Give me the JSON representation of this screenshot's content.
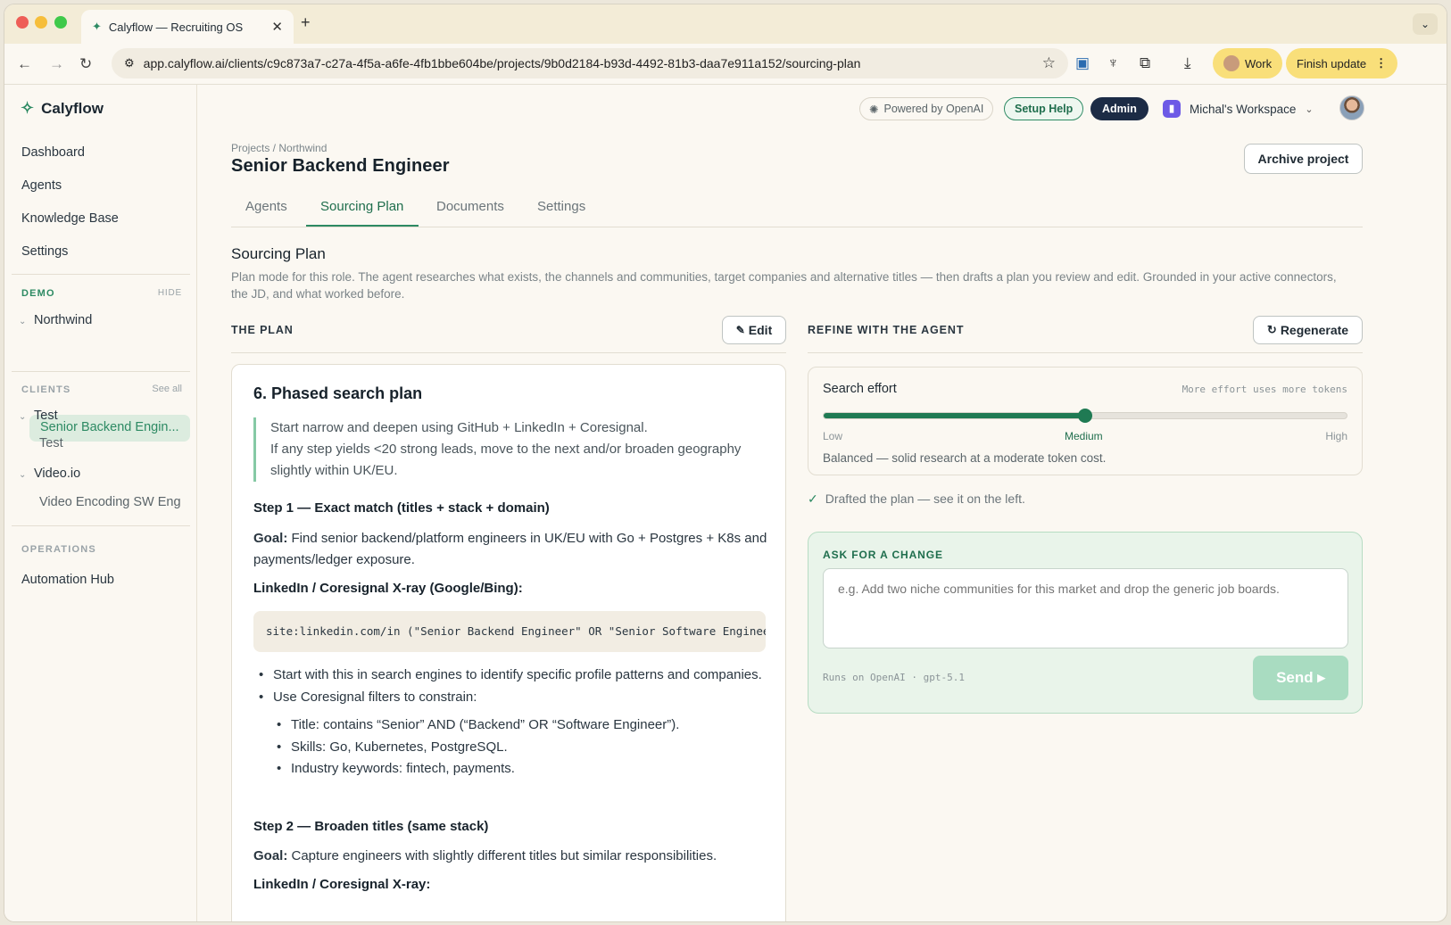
{
  "browser": {
    "tab_title": "Calyflow — Recruiting OS",
    "url": "app.calyflow.ai/clients/c9c873a7-c27a-4f5a-a6fe-4fb1bbe604be/projects/9b0d2184-b93d-4492-81b3-daa7e911a152/sourcing-plan",
    "profile_label": "Work",
    "update_label": "Finish update"
  },
  "sidebar": {
    "brand": "Calyflow",
    "nav": [
      "Dashboard",
      "Agents",
      "Knowledge Base",
      "Settings"
    ],
    "demo_label": "DEMO",
    "demo_hide": "HIDE",
    "demo_group": "Northwind",
    "demo_active": "Senior Backend Engin...",
    "clients_label": "CLIENTS",
    "clients_see_all": "See all",
    "client1": "Test",
    "client1_child": "Test",
    "client2": "Video.io",
    "client2_child": "Video Encoding SW Eng",
    "operations_label": "OPERATIONS",
    "operations_item": "Automation Hub"
  },
  "header": {
    "powered": "Powered by OpenAI",
    "setup_help": "Setup Help",
    "admin": "Admin",
    "workspace": "Michal's Workspace"
  },
  "page": {
    "breadcrumb": "Projects / Northwind",
    "title": "Senior Backend Engineer",
    "archive": "Archive project",
    "tabs": [
      "Agents",
      "Sourcing Plan",
      "Documents",
      "Settings"
    ],
    "section_title": "Sourcing Plan",
    "section_desc": "Plan mode for this role. The agent researches what exists, the channels and communities, target companies and alternative titles — then drafts a plan you review and edit. Grounded in your active connectors, the JD, and what worked before."
  },
  "plan": {
    "header": "THE PLAN",
    "edit": "Edit",
    "heading": "6. Phased search plan",
    "quote_1": "Start narrow and deepen using GitHub + LinkedIn + Coresignal.",
    "quote_2": "If any step yields <20 strong leads, move to the next and/or broaden geography slightly within UK/EU.",
    "step1_title": "Step 1 — Exact match (titles + stack + domain)",
    "goal_label": "Goal:",
    "step1_goal": " Find senior backend/platform engineers in UK/EU with Go + Postgres + K8s and payments/ledger exposure.",
    "xray_title": "LinkedIn / Coresignal X-ray (Google/Bing):",
    "xray_code": "site:linkedin.com/in (\"Senior Backend Engineer\" OR \"Senior Software Engineer\")",
    "bullet1": "Start with this in search engines to identify specific profile patterns and companies.",
    "bullet2": "Use Coresignal filters to constrain:",
    "sub1": "Title: contains “Senior” AND (“Backend” OR “Software Engineer”).",
    "sub2": "Skills: Go, Kubernetes, PostgreSQL.",
    "sub3": "Industry keywords: fintech, payments.",
    "step2_title": "Step 2 — Broaden titles (same stack)",
    "goal_label_2": "Goal:",
    "step2_goal": " Capture engineers with slightly different titles but similar responsibilities.",
    "xray_title_2": "LinkedIn / Coresignal X-ray:"
  },
  "refine": {
    "header": "REFINE WITH THE AGENT",
    "regenerate": "Regenerate",
    "effort_title": "Search effort",
    "effort_hint": "More effort uses more tokens",
    "effort_low": "Low",
    "effort_mid": "Medium",
    "effort_high": "High",
    "effort_level": 0.5,
    "effort_desc": "Balanced — solid research at a moderate token cost.",
    "drafted": "Drafted the plan — see it on the left.",
    "ask_label": "ASK FOR A CHANGE",
    "ask_placeholder": "e.g. Add two niche communities for this market and drop the generic job boards.",
    "runs_on": "Runs on OpenAI · gpt-5.1",
    "send": "Send ▸"
  },
  "colors": {
    "accent": "#2d8a63",
    "admin": "#1c2b45",
    "pill": "#f9df7a"
  }
}
